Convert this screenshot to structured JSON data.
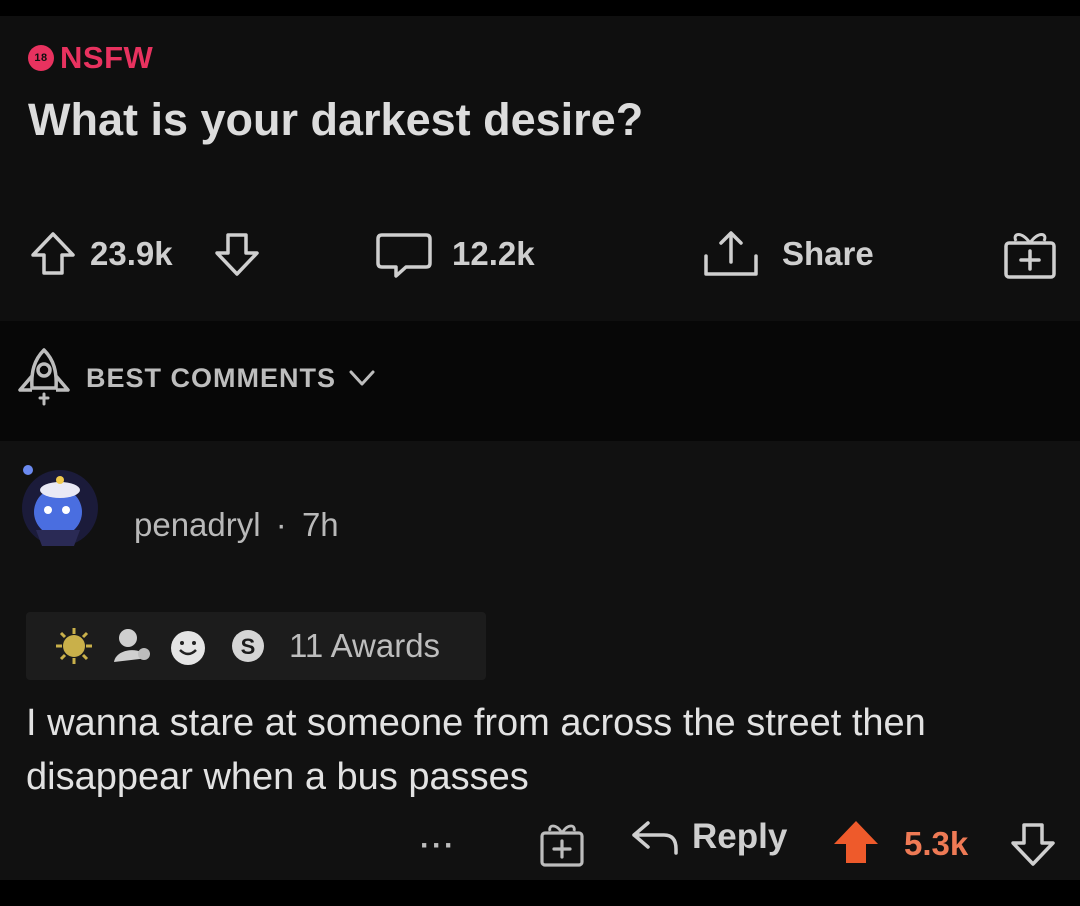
{
  "post": {
    "nsfw_label": "NSFW",
    "nsfw_icon_text": "18",
    "title": "What is your darkest desire?",
    "upvotes": "23.9k",
    "comments": "12.2k",
    "share_label": "Share"
  },
  "sort": {
    "label": "BEST COMMENTS"
  },
  "comment": {
    "author": "penadryl",
    "separator": "·",
    "age": "7h",
    "awards_label": "11 Awards",
    "text": "I wanna stare at someone from across the street then disappear when a bus passes",
    "more": "···",
    "reply_label": "Reply",
    "score": "5.3k"
  },
  "colors": {
    "nsfw": "#e8325f",
    "upvoted": "#ee5a2b",
    "background": "#0f0f0f"
  },
  "icons": [
    "upvote-icon",
    "downvote-icon",
    "comment-icon",
    "share-icon",
    "gift-icon",
    "rocket-icon",
    "chevron-down-icon",
    "reply-icon"
  ]
}
